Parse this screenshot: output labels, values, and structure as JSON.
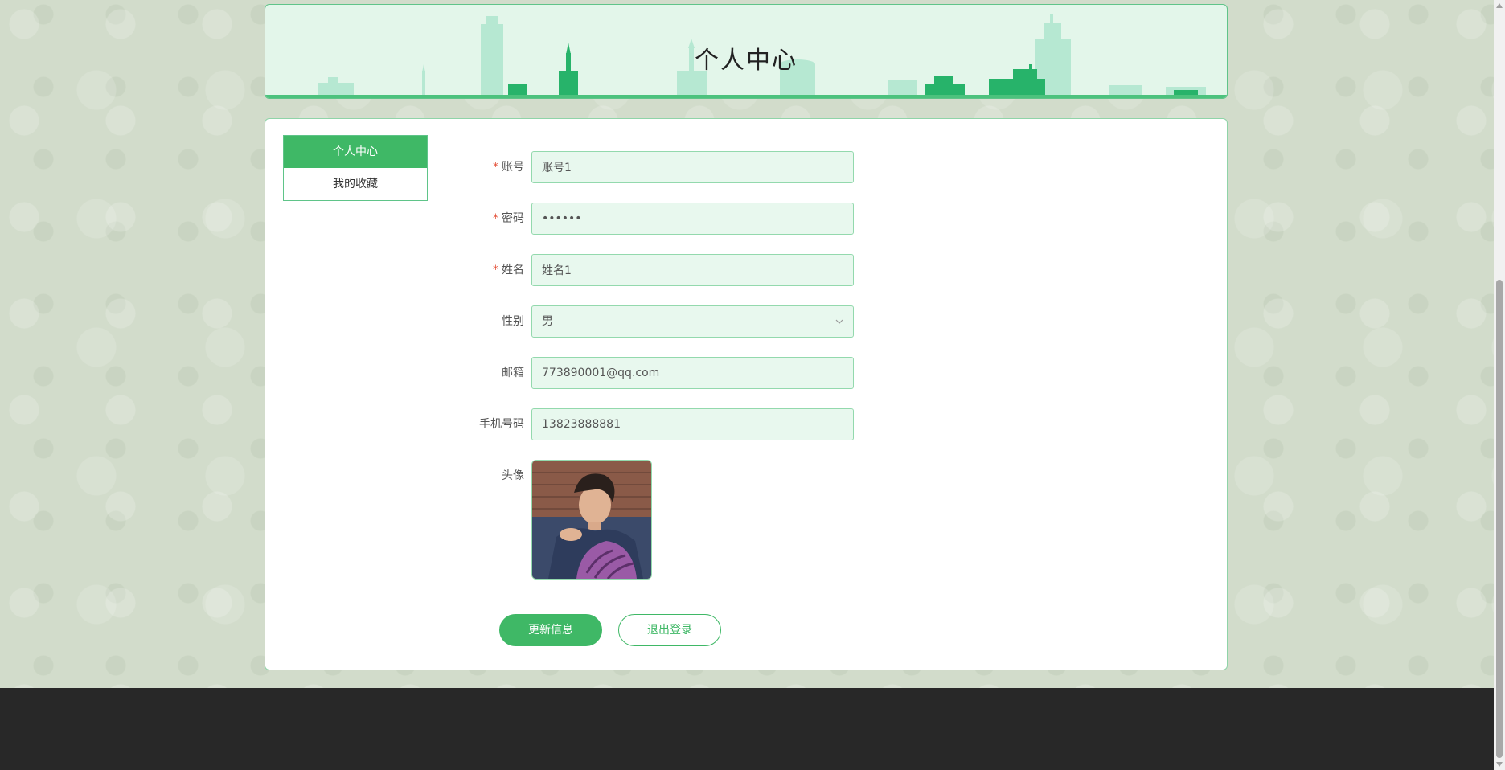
{
  "header": {
    "title": "个人中心"
  },
  "sidebar": {
    "items": [
      {
        "label": "个人中心",
        "active": true
      },
      {
        "label": "我的收藏",
        "active": false
      }
    ]
  },
  "form": {
    "account": {
      "label": "账号",
      "value": "账号1",
      "required": true
    },
    "password": {
      "label": "密码",
      "value": "••••••",
      "required": true
    },
    "name": {
      "label": "姓名",
      "value": "姓名1",
      "required": true
    },
    "gender": {
      "label": "性别",
      "value": "男",
      "required": false
    },
    "email": {
      "label": "邮箱",
      "value": "773890001@qq.com",
      "required": false
    },
    "phone": {
      "label": "手机号码",
      "value": "13823888881",
      "required": false
    },
    "avatar": {
      "label": "头像"
    }
  },
  "buttons": {
    "update": "更新信息",
    "logout": "退出登录"
  },
  "colors": {
    "accent": "#3fb866",
    "required": "#e5533c",
    "input_bg": "#e8f8ee",
    "footer": "#282828"
  }
}
